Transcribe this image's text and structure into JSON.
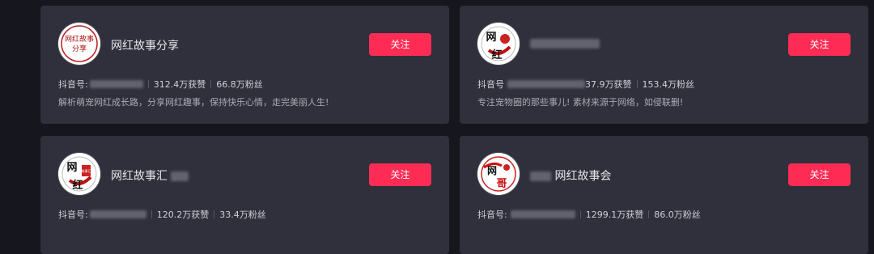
{
  "cards": [
    {
      "name": "网红故事分享",
      "id_label": "抖音号:",
      "likes": "312.4万获赞",
      "fans": "66.8万粉丝",
      "description": "解析萌宠网红成长路，分享网红趣事，保持快乐心情，走完美丽人生!",
      "follow_label": "关注",
      "avatar_text": [
        "网红故事",
        "分享"
      ]
    },
    {
      "name": "",
      "id_label": "抖音号",
      "likes": "37.9万获赞",
      "fans": "153.4万粉丝",
      "description": "专注宠物圈的那些事儿! 素材来源于网络，如侵联删!",
      "follow_label": "关注",
      "avatar_text": [
        "网",
        "红"
      ]
    },
    {
      "name": "网红故事汇",
      "id_label": "抖音号:",
      "likes": "120.2万获赞",
      "fans": "33.4万粉丝",
      "description": "",
      "follow_label": "关注",
      "avatar_text": [
        "网",
        "红",
        "故事汇"
      ]
    },
    {
      "name": "网红故事会",
      "id_label": "抖音号:",
      "likes": "1299.1万获赞",
      "fans": "86.0万粉丝",
      "description": "",
      "follow_label": "关注",
      "avatar_text": [
        "网",
        "哥"
      ]
    }
  ],
  "colors": {
    "accent": "#fe2c55",
    "card_bg": "#2f303b",
    "page_bg": "#16161f"
  }
}
